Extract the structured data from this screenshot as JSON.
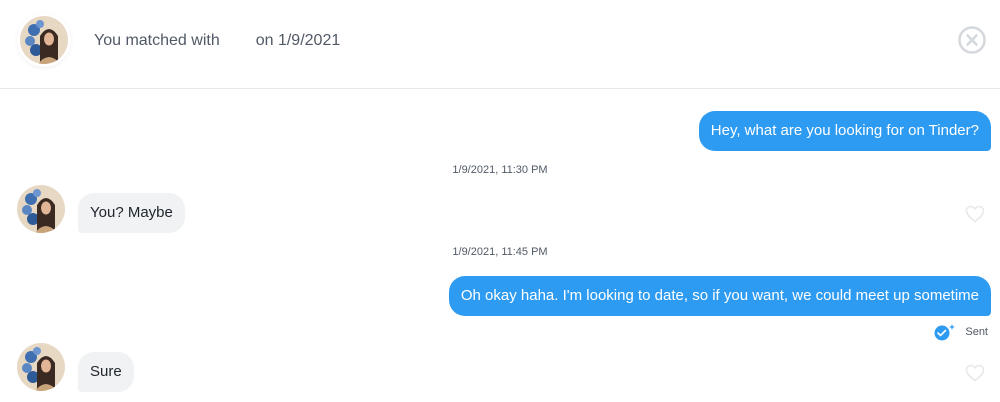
{
  "header": {
    "matched_prefix": "You matched with",
    "matched_suffix": "on 1/9/2021",
    "close_icon": "close-circle-icon"
  },
  "messages": [
    {
      "direction": "outgoing",
      "text": "Hey, what are you looking for on Tinder?"
    },
    {
      "type": "timestamp",
      "text": "1/9/2021, 11:30 PM"
    },
    {
      "direction": "incoming",
      "text": "You? Maybe",
      "like_icon": "heart-outline-icon"
    },
    {
      "type": "timestamp",
      "text": "1/9/2021, 11:45 PM"
    },
    {
      "direction": "outgoing",
      "text": "Oh okay haha. I'm looking to date, so if you want, we could meet up sometime"
    },
    {
      "direction": "incoming",
      "text": "Sure",
      "like_icon": "heart-outline-icon"
    }
  ],
  "receipt": {
    "status": "Sent",
    "icon": "sent-check-icon"
  },
  "colors": {
    "outgoing_bubble": "#2e9bf2",
    "incoming_bubble": "#f0f2f4",
    "secondary_text": "#505965"
  }
}
